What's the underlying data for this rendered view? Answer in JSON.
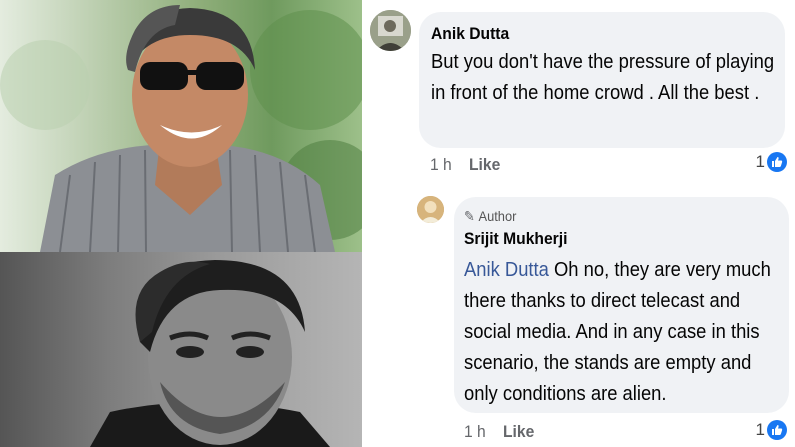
{
  "comments": [
    {
      "author": "Anik Dutta",
      "text": "But you don't have the pressure of playing in front of the  home crowd . All the best .",
      "time": "1 h",
      "like_label": "Like",
      "reaction_count": "1"
    },
    {
      "badge_label": "Author",
      "author": "Srijit Mukherji",
      "mention": "Anik Dutta",
      "text": " Oh no, they are very much there thanks to direct telecast and social media. And in any case in this scenario, the stands are empty and only conditions are alien.",
      "time": "1 h",
      "like_label": "Like",
      "reaction_count": "1"
    }
  ],
  "icons": {
    "badge": "pencil-icon",
    "reaction": "thumbs-up-icon"
  },
  "colors": {
    "bubble": "#f0f2f5",
    "mention": "#385898",
    "like_badge": "#1877f2"
  }
}
